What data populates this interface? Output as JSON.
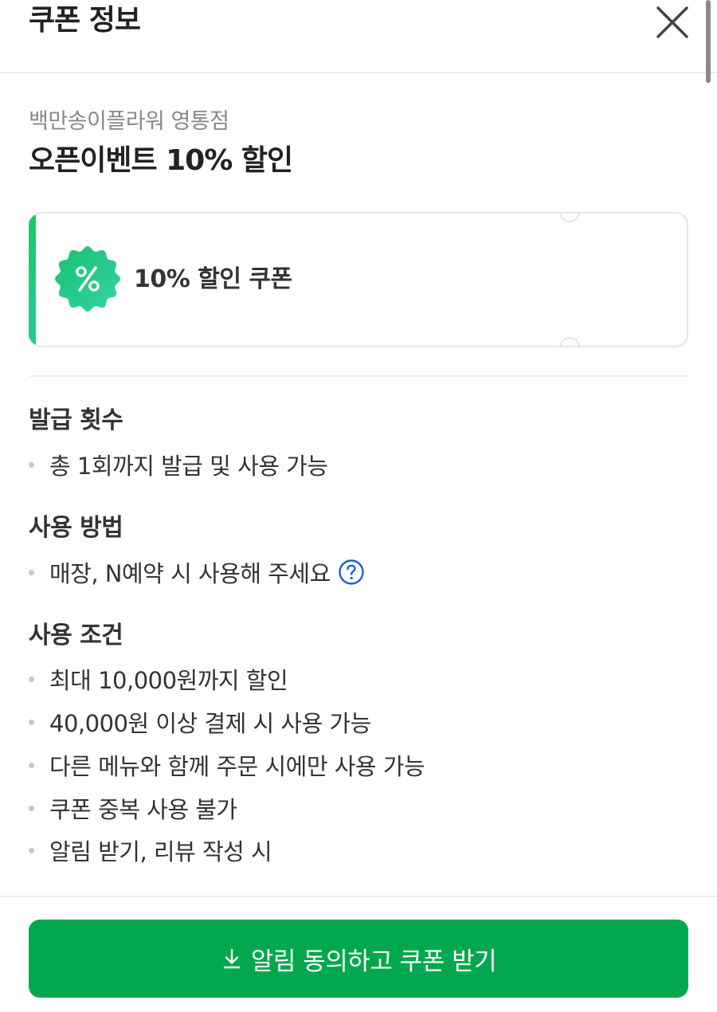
{
  "header": {
    "title": "쿠폰 정보",
    "close_icon": "close-icon"
  },
  "coupon": {
    "store_name": "백만송이플라워 영통점",
    "title": "오픈이벤트 10% 할인",
    "card_label": "10% 할인 쿠폰",
    "badge_icon": "percent-badge-icon",
    "badge_color": "#1dc78a",
    "accent_color": "#18c964"
  },
  "sections": [
    {
      "title": "발급 횟수",
      "items": [
        "총 1회까지 발급 및 사용 가능"
      ]
    },
    {
      "title": "사용 방법",
      "items": [
        "매장, N예약 시 사용해 주세요"
      ],
      "help_icon": "question-circle-icon"
    },
    {
      "title": "사용 조건",
      "items": [
        "최대 10,000원까지 할인",
        "40,000원 이상 결제 시 사용 가능",
        "다른 메뉴와 함께 주문 시에만 사용 가능",
        "쿠폰 중복 사용 불가",
        "알림 받기, 리뷰 작성 시"
      ]
    }
  ],
  "cta": {
    "label": "알림 동의하고 쿠폰 받기",
    "icon": "download-arrow-icon",
    "color": "#03a84e"
  }
}
